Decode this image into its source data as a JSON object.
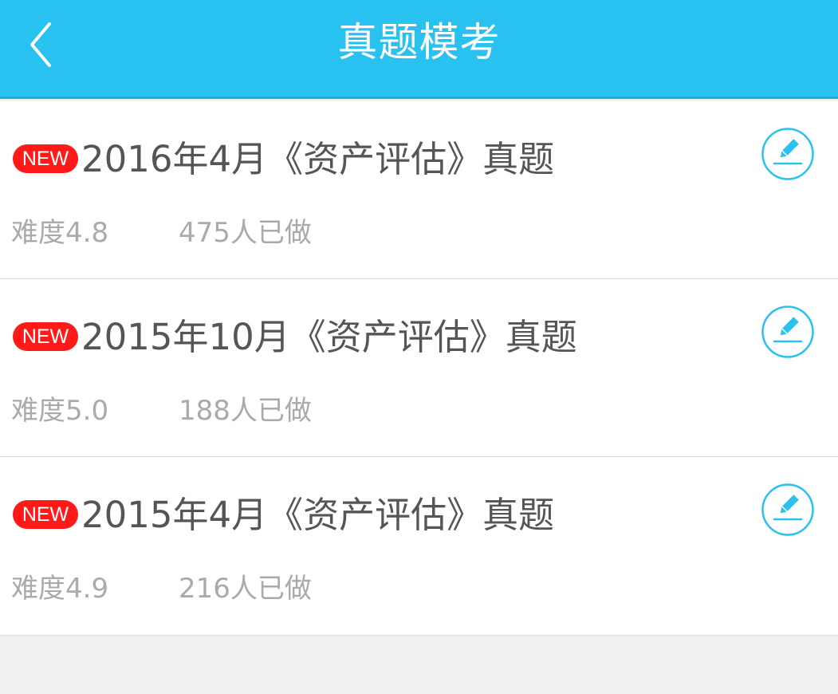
{
  "header": {
    "title": "真题模考",
    "back_icon": "chevron-left-icon"
  },
  "colors": {
    "header_bg": "#29c1f0",
    "badge_bg": "#ff1a1a",
    "accent": "#29c1f0"
  },
  "exams": [
    {
      "badge": "NEW",
      "title": "2016年4月《资产评估》真题",
      "difficulty": "难度4.8",
      "done_count": "475人已做",
      "action_icon": "edit-pencil-icon"
    },
    {
      "badge": "NEW",
      "title": "2015年10月《资产评估》真题",
      "difficulty": "难度5.0",
      "done_count": "188人已做",
      "action_icon": "edit-pencil-icon"
    },
    {
      "badge": "NEW",
      "title": "2015年4月《资产评估》真题",
      "difficulty": "难度4.9",
      "done_count": "216人已做",
      "action_icon": "edit-pencil-icon"
    }
  ]
}
